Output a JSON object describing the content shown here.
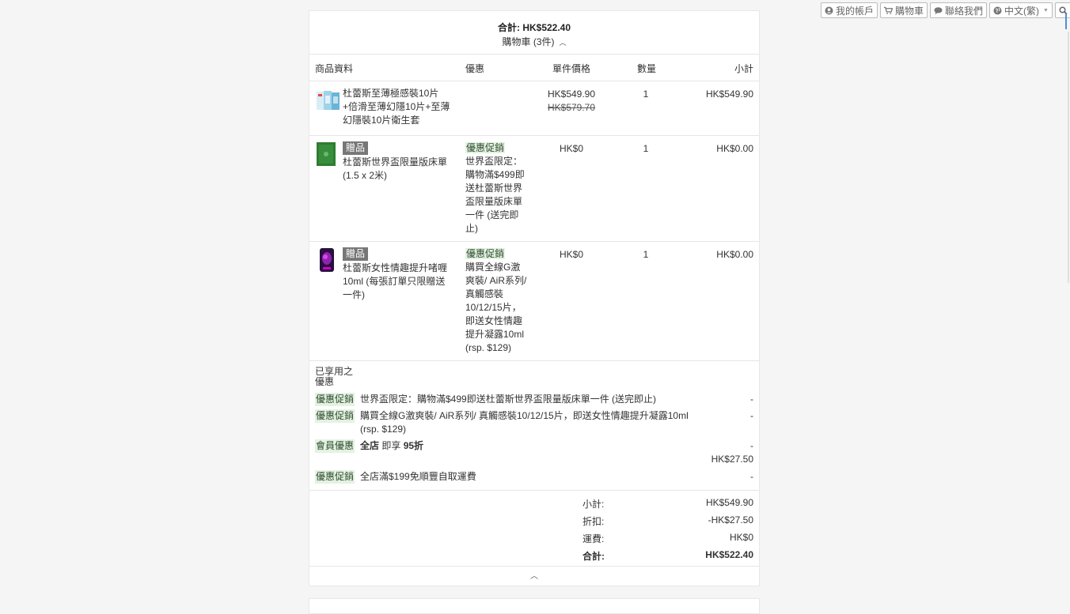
{
  "nav": {
    "account": "我的帳戶",
    "cart": "購物車",
    "contact": "聯絡我們",
    "language": "中文(繁)"
  },
  "summary": {
    "total_label": "合計:",
    "total_value": "HK$522.40",
    "cart_label": "購物車 (3件)"
  },
  "columns": {
    "product": "商品資料",
    "promo": "優惠",
    "unit_price": "單件價格",
    "qty": "數量",
    "subtotal": "小計"
  },
  "items": [
    {
      "name": "杜蕾斯至薄極感裝10片+倍滑至薄幻隱10片+至薄幻隱裝10片衛生套",
      "price": "HK$549.90",
      "original_price": "HK$579.70",
      "qty": "1",
      "subtotal": "HK$549.90",
      "thumb_color": "#9fd3e8"
    },
    {
      "gift_label": "贈品",
      "name": "杜蕾斯世界盃限量版床單(1.5 x 2米)",
      "promo_tag": "優惠促銷",
      "promo_text": "世界盃限定：購物滿$499即送杜蕾斯世界盃限量版床單一件 (送完即止)",
      "price": "HK$0",
      "qty": "1",
      "subtotal": "HK$0.00",
      "thumb_color": "#2e7d32"
    },
    {
      "gift_label": "贈品",
      "name": "杜蕾斯女性情趣提升啫喱10ml (每張訂單只限贈送一件)",
      "promo_tag": "優惠促銷",
      "promo_text": "購買全線G激爽裝/ AiR系列/ 真觸感裝10/12/15片，即送女性情趣提升凝露10ml (rsp. $129)",
      "price": "HK$0",
      "qty": "1",
      "subtotal": "HK$0.00",
      "thumb_color": "#4a1a6b"
    }
  ],
  "applied": {
    "title": "已享用之優惠",
    "rows": [
      {
        "tag": "優惠促銷",
        "text": "世界盃限定：購物滿$499即送杜蕾斯世界盃限量版床單一件 (送完即止)",
        "value": "-"
      },
      {
        "tag": "優惠促銷",
        "text": "購買全線G激爽裝/ AiR系列/ 真觸感裝10/12/15片，即送女性情趣提升凝露10ml (rsp. $129)",
        "value": "-"
      },
      {
        "tag": "會員優惠",
        "text_bold_1": "全店",
        "text_mid": " 即享 ",
        "text_bold_2": "95折",
        "value_1": "-",
        "value_2": "HK$27.50"
      },
      {
        "tag": "優惠促銷",
        "text": "全店滿$199免順豐自取運費",
        "value": "-"
      }
    ]
  },
  "totals": {
    "subtotal_label": "小計:",
    "subtotal_value": "HK$549.90",
    "discount_label": "折扣:",
    "discount_value": "-HK$27.50",
    "shipping_label": "運費:",
    "shipping_value": "HK$0",
    "total_label": "合計:",
    "total_value": "HK$522.40"
  }
}
